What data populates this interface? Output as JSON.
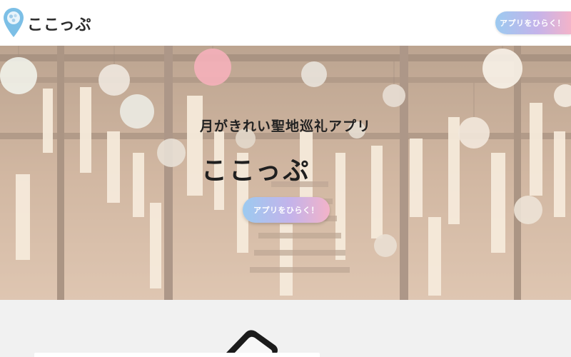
{
  "header": {
    "logo_text": "ここっぷ",
    "cta_label": "アプリをひらく！"
  },
  "hero": {
    "tagline": "月がきれい聖地巡礼アプリ",
    "title": "ここっぷ",
    "cta_label": "アプリをひらく！"
  },
  "colors": {
    "cta_gradient": [
      "#9ccaf0",
      "#c4b3ea",
      "#f3b3c9"
    ],
    "logo_pin": "#6fb7e0",
    "text_dark": "#222222",
    "section_bg": "#f1f1f1"
  }
}
